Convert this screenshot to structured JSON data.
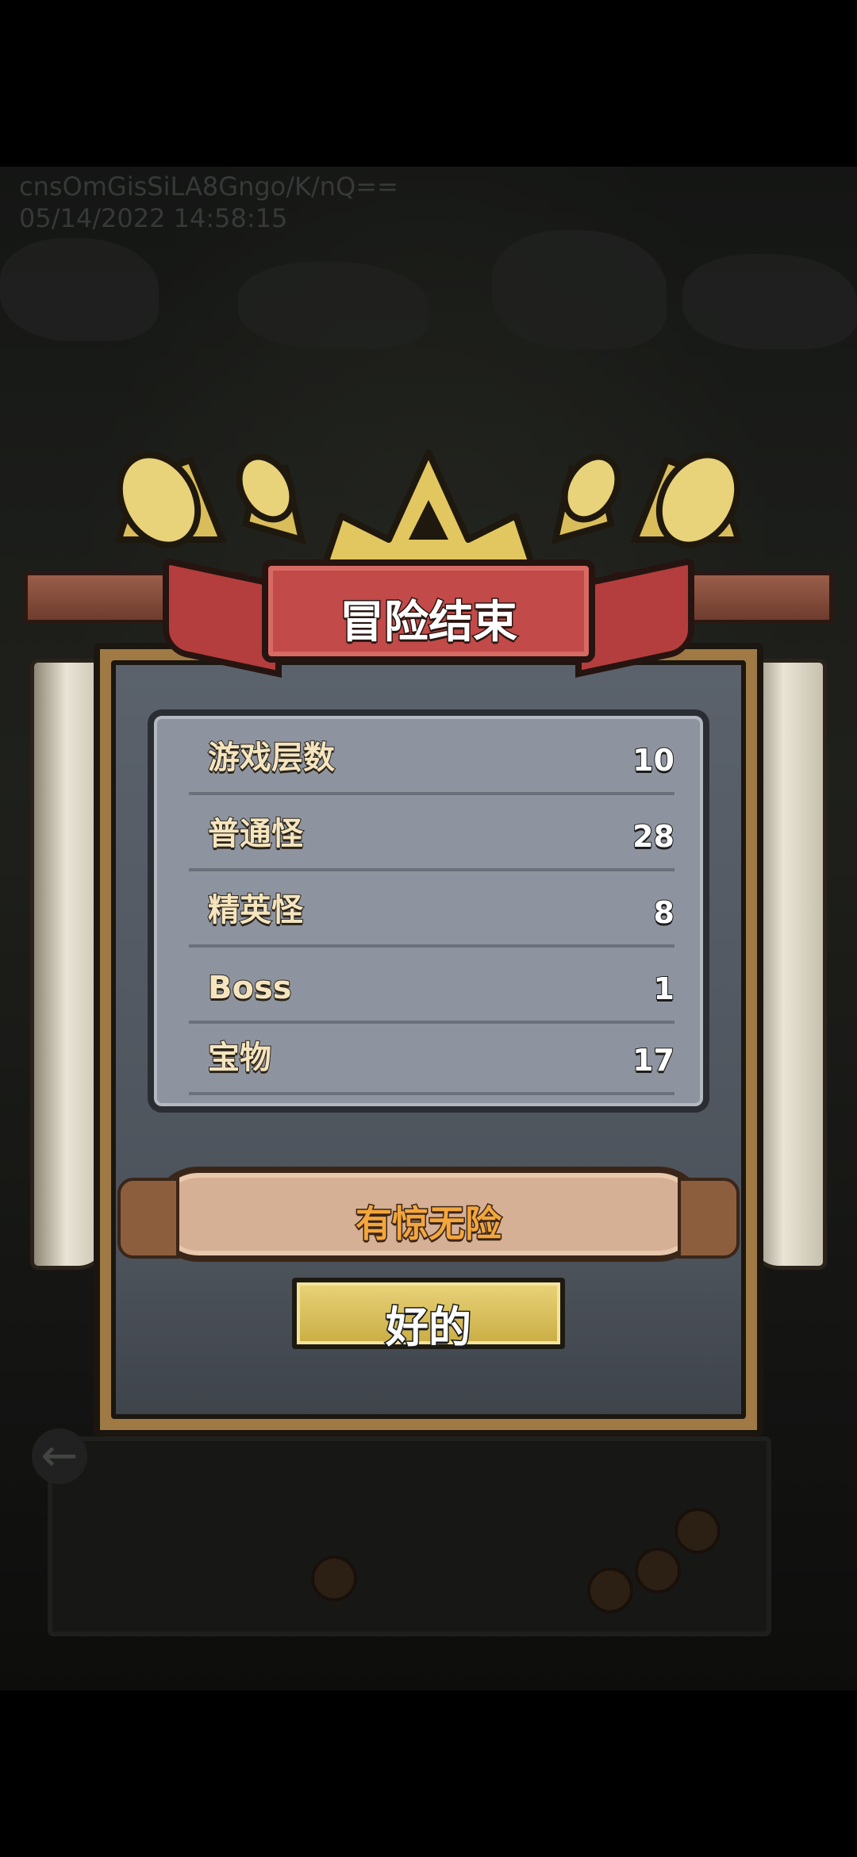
{
  "watermark": {
    "line1": "cnsOmGisSiLA8Gngo/K/nQ==",
    "line2": "05/14/2022 14:58:15"
  },
  "dialog": {
    "title": "冒险结束",
    "stats": [
      {
        "label": "游戏层数",
        "value": "10"
      },
      {
        "label": "普通怪",
        "value": "28"
      },
      {
        "label": "精英怪",
        "value": "8"
      },
      {
        "label": "Boss",
        "value": "1"
      },
      {
        "label": "宝物",
        "value": "17"
      }
    ],
    "rating": "有惊无险",
    "ok_label": "好的"
  },
  "icons": {
    "crown": "crown-icon",
    "horns": "horn-icon",
    "back": "back-arrow-icon"
  },
  "colors": {
    "ribbon": "#c24a48",
    "rating_text": "#f2a63c",
    "button": "#d9c05c",
    "label_text": "#f4e5bf"
  }
}
